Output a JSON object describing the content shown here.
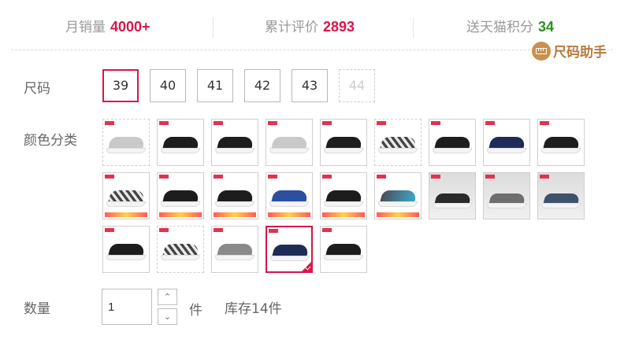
{
  "stats": {
    "monthly_sales": {
      "label": "月销量",
      "value": "4000+",
      "color": "#d8164a"
    },
    "total_reviews": {
      "label": "累计评价",
      "value": "2893",
      "color": "#d8164a"
    },
    "tmall_points": {
      "label": "送天猫积分",
      "value": "34",
      "color": "#2f8f1f"
    }
  },
  "size_helper": {
    "label": "尺码助手",
    "icon": "ruler-icon"
  },
  "size": {
    "label": "尺码",
    "options": [
      {
        "value": "39",
        "state": "selected"
      },
      {
        "value": "40",
        "state": "normal"
      },
      {
        "value": "41",
        "state": "normal"
      },
      {
        "value": "42",
        "state": "normal"
      },
      {
        "value": "43",
        "state": "normal"
      },
      {
        "value": "44",
        "state": "disabled"
      }
    ]
  },
  "color": {
    "label": "颜色分类",
    "swatches": [
      {
        "style": "light",
        "state": "disabled"
      },
      {
        "style": "dark",
        "state": "normal"
      },
      {
        "style": "dark",
        "state": "normal"
      },
      {
        "style": "light",
        "state": "normal"
      },
      {
        "style": "dark",
        "state": "normal"
      },
      {
        "style": "check",
        "state": "disabled"
      },
      {
        "style": "dark",
        "state": "normal"
      },
      {
        "style": "navy",
        "state": "normal"
      },
      {
        "style": "dark",
        "state": "normal"
      },
      {
        "style": "check",
        "state": "normal"
      },
      {
        "style": "dark",
        "state": "normal"
      },
      {
        "style": "dark",
        "state": "normal"
      },
      {
        "style": "blue",
        "state": "normal"
      },
      {
        "style": "dark",
        "state": "normal"
      },
      {
        "style": "teal",
        "state": "normal"
      },
      {
        "style": "loafer-dark",
        "state": "normal"
      },
      {
        "style": "loafer-gray",
        "state": "normal"
      },
      {
        "style": "loafer-blue",
        "state": "normal"
      },
      {
        "style": "dark",
        "state": "normal"
      },
      {
        "style": "check",
        "state": "disabled"
      },
      {
        "style": "gray",
        "state": "normal"
      },
      {
        "style": "navy",
        "state": "selected"
      },
      {
        "style": "dark",
        "state": "normal"
      }
    ]
  },
  "quantity": {
    "label": "数量",
    "value": "1",
    "unit": "件",
    "stock": "库存14件",
    "increment_icon": "chevron-up-icon",
    "decrement_icon": "chevron-down-icon"
  },
  "accent_color": "#d8164a"
}
